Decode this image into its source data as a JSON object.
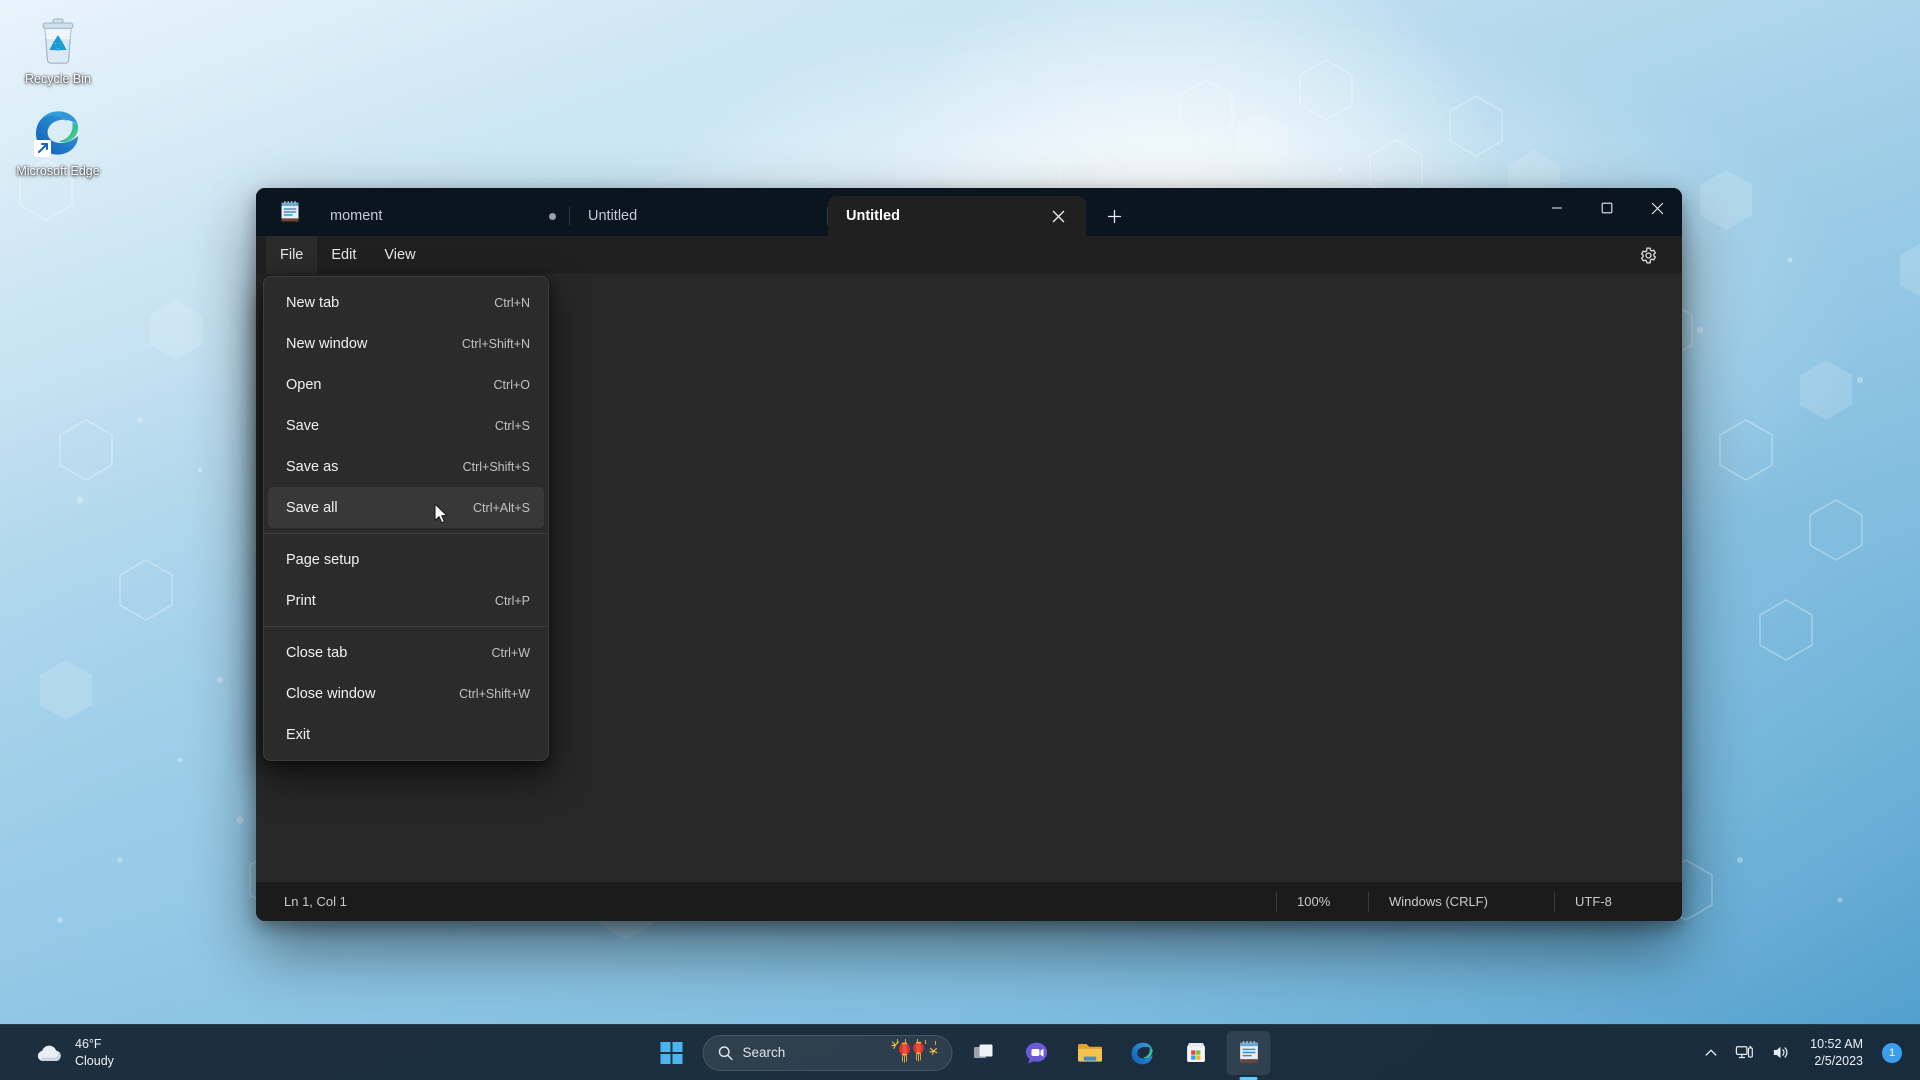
{
  "desktop": {
    "icons": [
      {
        "name": "recycle-bin",
        "label": "Recycle Bin",
        "icon": "recycle-bin-icon"
      },
      {
        "name": "microsoft-edge",
        "label": "Microsoft Edge",
        "icon": "edge-shortcut-icon"
      }
    ]
  },
  "window": {
    "app_icon": "notepad-icon",
    "tabs": [
      {
        "title": "moment",
        "modified": true,
        "active": false
      },
      {
        "title": "Untitled",
        "modified": false,
        "active": false
      },
      {
        "title": "Untitled",
        "modified": false,
        "active": true
      }
    ],
    "new_tab_label": "+",
    "close_tab_label": "✕",
    "controls": {
      "minimize": "—",
      "maximize": "□",
      "close": "✕"
    },
    "menubar": {
      "items": [
        {
          "label": "File",
          "open": true
        },
        {
          "label": "Edit",
          "open": false
        },
        {
          "label": "View",
          "open": false
        }
      ],
      "settings_icon": "gear-icon"
    },
    "editor": {
      "content": ""
    },
    "statusbar": {
      "position": "Ln 1, Col 1",
      "zoom": "100%",
      "line_ending": "Windows (CRLF)",
      "encoding": "UTF-8"
    }
  },
  "file_menu": {
    "items": [
      {
        "label": "New tab",
        "accel": "Ctrl+N",
        "hover": false,
        "separator_after": false
      },
      {
        "label": "New window",
        "accel": "Ctrl+Shift+N",
        "hover": false,
        "separator_after": false
      },
      {
        "label": "Open",
        "accel": "Ctrl+O",
        "hover": false,
        "separator_after": false
      },
      {
        "label": "Save",
        "accel": "Ctrl+S",
        "hover": false,
        "separator_after": false
      },
      {
        "label": "Save as",
        "accel": "Ctrl+Shift+S",
        "hover": false,
        "separator_after": false
      },
      {
        "label": "Save all",
        "accel": "Ctrl+Alt+S",
        "hover": true,
        "separator_after": true
      },
      {
        "label": "Page setup",
        "accel": "",
        "hover": false,
        "separator_after": false
      },
      {
        "label": "Print",
        "accel": "Ctrl+P",
        "hover": false,
        "separator_after": true
      },
      {
        "label": "Close tab",
        "accel": "Ctrl+W",
        "hover": false,
        "separator_after": false
      },
      {
        "label": "Close window",
        "accel": "Ctrl+Shift+W",
        "hover": false,
        "separator_after": false
      },
      {
        "label": "Exit",
        "accel": "",
        "hover": false,
        "separator_after": false
      }
    ]
  },
  "taskbar": {
    "weather": {
      "temperature": "46°F",
      "condition": "Cloudy",
      "icon": "cloud-icon"
    },
    "start": {
      "label": "Start",
      "icon": "windows-logo-icon"
    },
    "search": {
      "placeholder": "Search",
      "icon": "search-icon",
      "decoration": "lanterns-icon"
    },
    "apps": [
      {
        "name": "task-view",
        "icon": "task-view-icon",
        "active": false
      },
      {
        "name": "chat",
        "icon": "chat-video-icon",
        "active": false
      },
      {
        "name": "file-explorer",
        "icon": "folder-icon",
        "active": false
      },
      {
        "name": "microsoft-edge",
        "icon": "edge-icon",
        "active": false
      },
      {
        "name": "microsoft-store",
        "icon": "store-icon",
        "active": false
      },
      {
        "name": "notepad",
        "icon": "notepad-icon",
        "active": true
      }
    ],
    "tray": {
      "chevron": "show-hidden-icons-icon",
      "network": "network-icon",
      "volume": "volume-icon",
      "time": "10:52 AM",
      "date": "2/5/2023",
      "notification_count": "1"
    }
  },
  "colors": {
    "accent": "#60cdff",
    "window_bg": "#202020",
    "editor_bg": "#272727",
    "menu_bg": "#2b2b2b",
    "menu_hover": "#383838",
    "titlebar_bg": "#0a1520",
    "taskbar_bg": "#142433",
    "status_bg": "#1b1b1b",
    "badge": "#3b9eea"
  }
}
